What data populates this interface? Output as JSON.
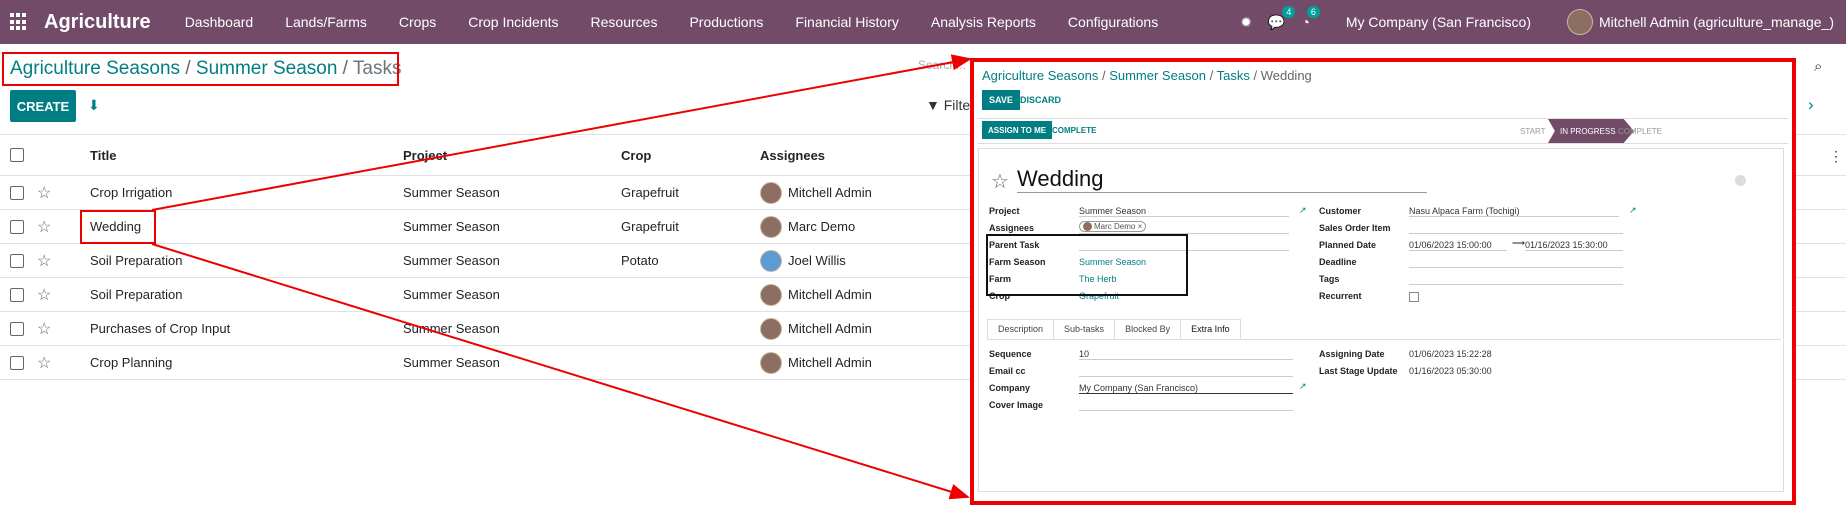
{
  "nav": {
    "brand": "Agriculture",
    "menu": [
      "Dashboard",
      "Lands/Farms",
      "Crops",
      "Crop Incidents",
      "Resources",
      "Productions",
      "Financial History",
      "Analysis Reports",
      "Configurations"
    ],
    "messages_count": "4",
    "activities_count": "6",
    "company": "My Company (San Francisco)",
    "user": "Mitchell Admin (agriculture_manage_)"
  },
  "breadcrumb": {
    "first": "Agriculture Seasons",
    "sep1": " / ",
    "second": "Summer Season",
    "sep2": " / ",
    "current": "Tasks"
  },
  "controls": {
    "create_label": "CREATE",
    "search_placeholder": "Search...",
    "filters_label": "Filter"
  },
  "table": {
    "headers": {
      "title": "Title",
      "project": "Project",
      "crop": "Crop",
      "assignees": "Assignees"
    },
    "rows": [
      {
        "title": "Crop Irrigation",
        "project": "Summer Season",
        "crop": "Grapefruit",
        "assignee": "Mitchell Admin"
      },
      {
        "title": "Wedding",
        "project": "Summer Season",
        "crop": "Grapefruit",
        "assignee": "Marc Demo"
      },
      {
        "title": "Soil Preparation",
        "project": "Summer Season",
        "crop": "Potato",
        "assignee": "Joel Willis"
      },
      {
        "title": "Soil Preparation",
        "project": "Summer Season",
        "crop": "",
        "assignee": "Mitchell Admin"
      },
      {
        "title": "Purchases of Crop Input",
        "project": "Summer Season",
        "crop": "",
        "assignee": "Mitchell Admin"
      },
      {
        "title": "Crop Planning",
        "project": "Summer Season",
        "crop": "",
        "assignee": "Mitchell Admin"
      }
    ]
  },
  "form": {
    "breadcrumb": {
      "first": "Agriculture Seasons",
      "second": "Summer Season",
      "third": "Tasks",
      "current": "Wedding",
      "sep": " / "
    },
    "save_label": "SAVE",
    "discard_label": "DISCARD",
    "assign_label": "ASSIGN TO ME",
    "complete_label": "COMPLETE",
    "stages": {
      "start": "START",
      "in_progress": "IN PROGRESS",
      "complete": "COMPLETE"
    },
    "title": "Wedding",
    "left_fields": {
      "project_label": "Project",
      "project_value": "Summer Season",
      "assignees_label": "Assignees",
      "assignee_tag": "Marc Demo",
      "parent_label": "Parent Task",
      "farm_season_label": "Farm Season",
      "farm_season_value": "Summer Season",
      "farm_label": "Farm",
      "farm_value": "The Herb",
      "crop_label": "Crop",
      "crop_value": "Grapefruit"
    },
    "right_fields": {
      "customer_label": "Customer",
      "customer_value": "Nasu Alpaca Farm (Tochigi)",
      "sales_order_label": "Sales Order Item",
      "planned_date_label": "Planned Date",
      "planned_start": "01/06/2023 15:00:00",
      "planned_end": "01/16/2023 15:30:00",
      "deadline_label": "Deadline",
      "tags_label": "Tags",
      "recurrent_label": "Recurrent"
    },
    "tabs": [
      "Description",
      "Sub-tasks",
      "Blocked By",
      "Extra Info"
    ],
    "extra": {
      "sequence_label": "Sequence",
      "sequence_value": "10",
      "email_cc_label": "Email cc",
      "company_label": "Company",
      "company_value": "My Company (San Francisco)",
      "cover_image_label": "Cover Image",
      "assigning_date_label": "Assigning Date",
      "assigning_date_value": "01/06/2023 15:22:28",
      "last_stage_label": "Last Stage Update",
      "last_stage_value": "01/16/2023 05:30:00"
    }
  },
  "colors": {
    "nav": "#714b67",
    "accent": "#017e84",
    "highlight": "#e00000"
  }
}
